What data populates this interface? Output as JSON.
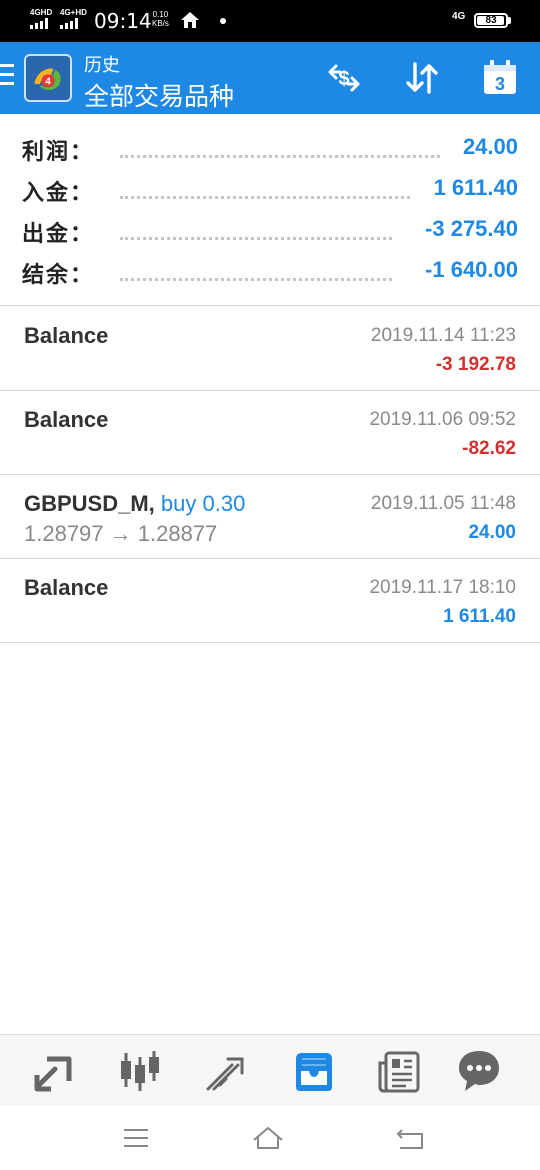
{
  "status_bar": {
    "sim1": "4GHD",
    "sim2": "4G+HD",
    "time": "09:14",
    "speed_value": "0.10",
    "speed_unit": "KB/s",
    "network": "4G",
    "battery": "83"
  },
  "header": {
    "title": "历史",
    "subtitle": "全部交易品种",
    "icons": [
      "menu-icon",
      "mt4-logo",
      "currency-exchange-icon",
      "sort-icon",
      "calendar-icon"
    ],
    "calendar_day": "3"
  },
  "summary": [
    {
      "label": "利润：",
      "value": "24.00"
    },
    {
      "label": "入金：",
      "value": "1 611.40"
    },
    {
      "label": "出金：",
      "value": "-3 275.40"
    },
    {
      "label": "结余：",
      "value": "-1 640.00"
    }
  ],
  "records": [
    {
      "title": "Balance",
      "action": "",
      "prices": "",
      "date": "2019.11.14 11:23",
      "amount": "-3 192.78",
      "sign": "negative"
    },
    {
      "title": "Balance",
      "action": "",
      "prices": "",
      "date": "2019.11.06 09:52",
      "amount": "-82.62",
      "sign": "negative"
    },
    {
      "title": "GBPUSD_M,",
      "action": "buy 0.30",
      "prices": "1.28797 → 1.28877",
      "date": "2019.11.05 11:48",
      "amount": "24.00",
      "sign": "positive"
    },
    {
      "title": "Balance",
      "action": "",
      "prices": "",
      "date": "2019.11.17 18:10",
      "amount": "1 611.40",
      "sign": "positive"
    }
  ],
  "tabs": [
    "quotes-icon",
    "chart-icon",
    "trade-icon",
    "history-icon",
    "news-icon",
    "chat-icon"
  ],
  "active_tab": "history-icon",
  "colors": {
    "accent": "#1e88e5",
    "negative": "#d32f2f",
    "text": "#333333",
    "muted": "#8a8a8a"
  }
}
